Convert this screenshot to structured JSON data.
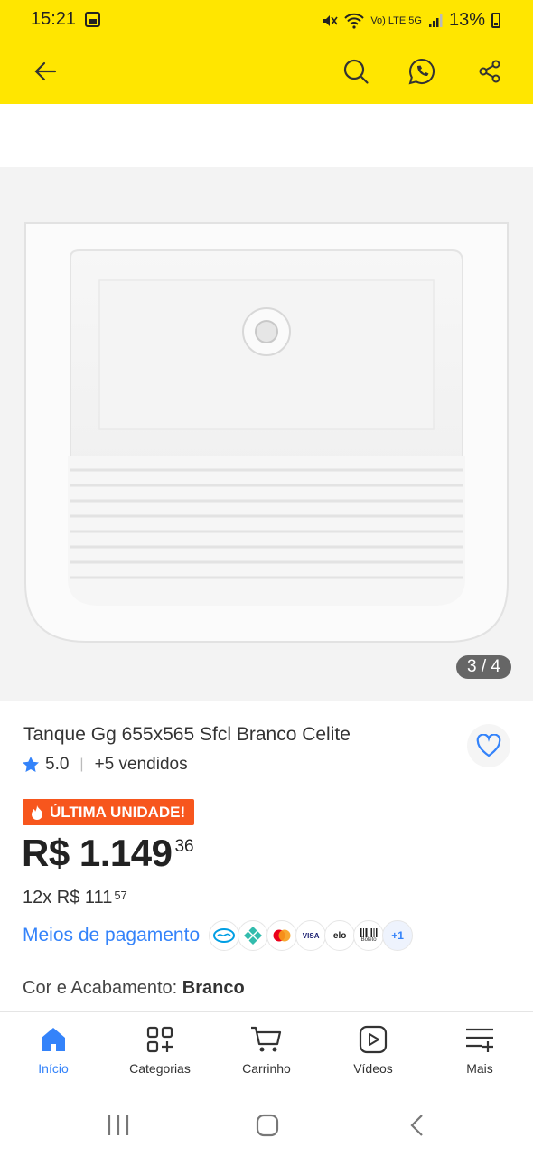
{
  "status_bar": {
    "time": "15:21",
    "network": "Vo) LTE 5G",
    "battery": "13%"
  },
  "product": {
    "image_counter": "3 / 4",
    "title": "Tanque Gg 655x565 Sfcl Branco Celite",
    "rating": "5.0",
    "sold": "+5 vendidos",
    "badge": "ÚLTIMA UNIDADE!",
    "price_main": "R$ 1.149",
    "price_cents": "36",
    "installments": "12x R$ 111",
    "installments_cents": "57",
    "payments_label": "Meios de pagamento",
    "payment_icons": [
      "mercadopago-icon",
      "pix-icon",
      "mastercard-icon",
      "visa-icon",
      "elo-icon",
      "boleto-icon"
    ],
    "payment_visa": "VISA",
    "payment_elo": "elo",
    "payment_boleto": "Boleto",
    "payments_more": "+1",
    "option_label": "Cor e Acabamento:",
    "option_value": "Branco"
  },
  "bottom_nav": [
    {
      "label": "Início",
      "icon": "home-icon",
      "active": true
    },
    {
      "label": "Categorias",
      "icon": "categories-icon"
    },
    {
      "label": "Carrinho",
      "icon": "cart-icon"
    },
    {
      "label": "Vídeos",
      "icon": "video-icon"
    },
    {
      "label": "Mais",
      "icon": "more-icon"
    }
  ],
  "colors": {
    "brand_yellow": "#ffe600",
    "accent_blue": "#3483fa",
    "badge_orange": "#f7561d"
  }
}
